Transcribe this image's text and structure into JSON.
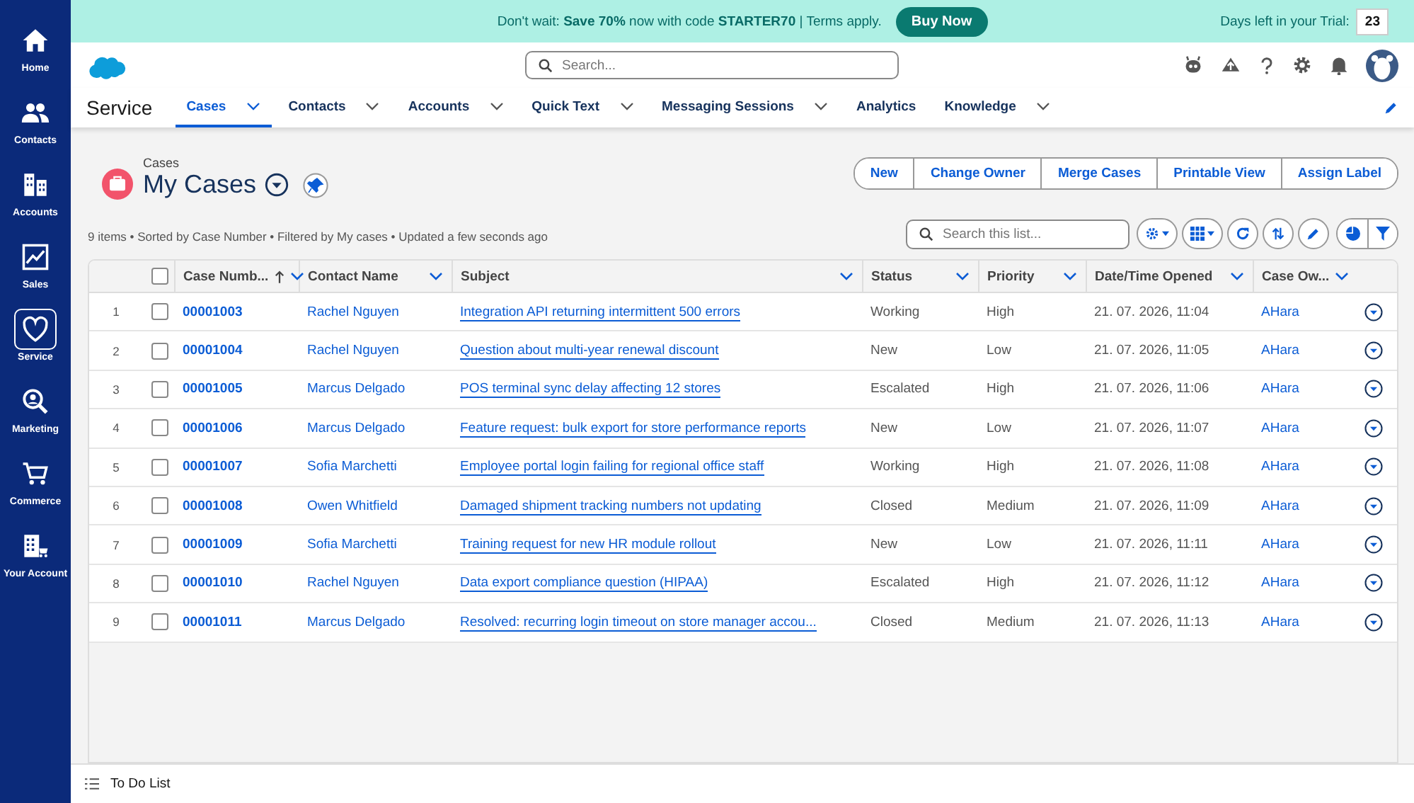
{
  "banner": {
    "message": "Don't wait: **Save 70%** now with code **STARTER70** | Terms apply.",
    "button": "Buy Now",
    "trial_label": "Days left in your Trial:",
    "trial_days": "23"
  },
  "sidebar": {
    "items": [
      {
        "label": "Home",
        "selected": false
      },
      {
        "label": "Contacts",
        "selected": false
      },
      {
        "label": "Accounts",
        "selected": false
      },
      {
        "label": "Sales",
        "selected": false
      },
      {
        "label": "Service",
        "selected": true
      },
      {
        "label": "Marketing",
        "selected": false
      },
      {
        "label": "Commerce",
        "selected": false
      },
      {
        "label": "Your Account",
        "selected": false
      }
    ]
  },
  "header": {
    "search_placeholder": "Search..."
  },
  "nav": {
    "app_name": "Service",
    "tabs": [
      {
        "label": "Cases",
        "selected": true,
        "has_menu": true
      },
      {
        "label": "Contacts",
        "selected": false,
        "has_menu": true
      },
      {
        "label": "Accounts",
        "selected": false,
        "has_menu": true
      },
      {
        "label": "Quick Text",
        "selected": false,
        "has_menu": true
      },
      {
        "label": "Messaging Sessions",
        "selected": false,
        "has_menu": true
      },
      {
        "label": "Analytics",
        "selected": false,
        "has_menu": false
      },
      {
        "label": "Knowledge",
        "selected": false,
        "has_menu": true
      }
    ]
  },
  "list_view": {
    "breadcrumb": "Cases",
    "title": "My Cases",
    "meta": "9 items • Sorted by Case Number • Filtered by My cases • Updated a few seconds ago",
    "actions": [
      "New",
      "Change Owner",
      "Merge Cases",
      "Printable View",
      "Assign Label"
    ],
    "search_placeholder": "Search this list..."
  },
  "table": {
    "all_checked": false,
    "columns": [
      {
        "label": "Case Numb...",
        "sorted": true
      },
      {
        "label": "Contact Name",
        "sorted": false
      },
      {
        "label": "Subject",
        "sorted": false
      },
      {
        "label": "Status",
        "sorted": false
      },
      {
        "label": "Priority",
        "sorted": false
      },
      {
        "label": "Date/Time Opened",
        "sorted": false
      },
      {
        "label": "Case Ow...",
        "sorted": false
      }
    ],
    "rows": [
      {
        "index": "1",
        "checked": false,
        "case_number": "00001003",
        "contact": "Rachel Nguyen",
        "subject": "Integration API returning intermittent 500 errors",
        "status": "Working",
        "priority": "High",
        "opened": "21. 07. 2026, 11:04",
        "owner": "AHara"
      },
      {
        "index": "2",
        "checked": false,
        "case_number": "00001004",
        "contact": "Rachel Nguyen",
        "subject": "Question about multi-year renewal discount",
        "status": "New",
        "priority": "Low",
        "opened": "21. 07. 2026, 11:05",
        "owner": "AHara"
      },
      {
        "index": "3",
        "checked": false,
        "case_number": "00001005",
        "contact": "Marcus Delgado",
        "subject": "POS terminal sync delay affecting 12 stores",
        "status": "Escalated",
        "priority": "High",
        "opened": "21. 07. 2026, 11:06",
        "owner": "AHara"
      },
      {
        "index": "4",
        "checked": false,
        "case_number": "00001006",
        "contact": "Marcus Delgado",
        "subject": "Feature request: bulk export for store performance reports",
        "status": "New",
        "priority": "Low",
        "opened": "21. 07. 2026, 11:07",
        "owner": "AHara"
      },
      {
        "index": "5",
        "checked": false,
        "case_number": "00001007",
        "contact": "Sofia Marchetti",
        "subject": "Employee portal login failing for regional office staff",
        "status": "Working",
        "priority": "High",
        "opened": "21. 07. 2026, 11:08",
        "owner": "AHara"
      },
      {
        "index": "6",
        "checked": false,
        "case_number": "00001008",
        "contact": "Owen Whitfield",
        "subject": "Damaged shipment tracking numbers not updating",
        "status": "Closed",
        "priority": "Medium",
        "opened": "21. 07. 2026, 11:09",
        "owner": "AHara"
      },
      {
        "index": "7",
        "checked": false,
        "case_number": "00001009",
        "contact": "Sofia Marchetti",
        "subject": "Training request for new HR module rollout",
        "status": "New",
        "priority": "Low",
        "opened": "21. 07. 2026, 11:11",
        "owner": "AHara"
      },
      {
        "index": "8",
        "checked": false,
        "case_number": "00001010",
        "contact": "Rachel Nguyen",
        "subject": "Data export compliance question (HIPAA)",
        "status": "Escalated",
        "priority": "High",
        "opened": "21. 07. 2026, 11:12",
        "owner": "AHara"
      },
      {
        "index": "9",
        "checked": false,
        "case_number": "00001011",
        "contact": "Marcus Delgado",
        "subject": "Resolved: recurring login timeout on store manager accou...",
        "status": "Closed",
        "priority": "Medium",
        "opened": "21. 07. 2026, 11:13",
        "owner": "AHara"
      }
    ]
  },
  "footer": {
    "label": "To Do List"
  }
}
